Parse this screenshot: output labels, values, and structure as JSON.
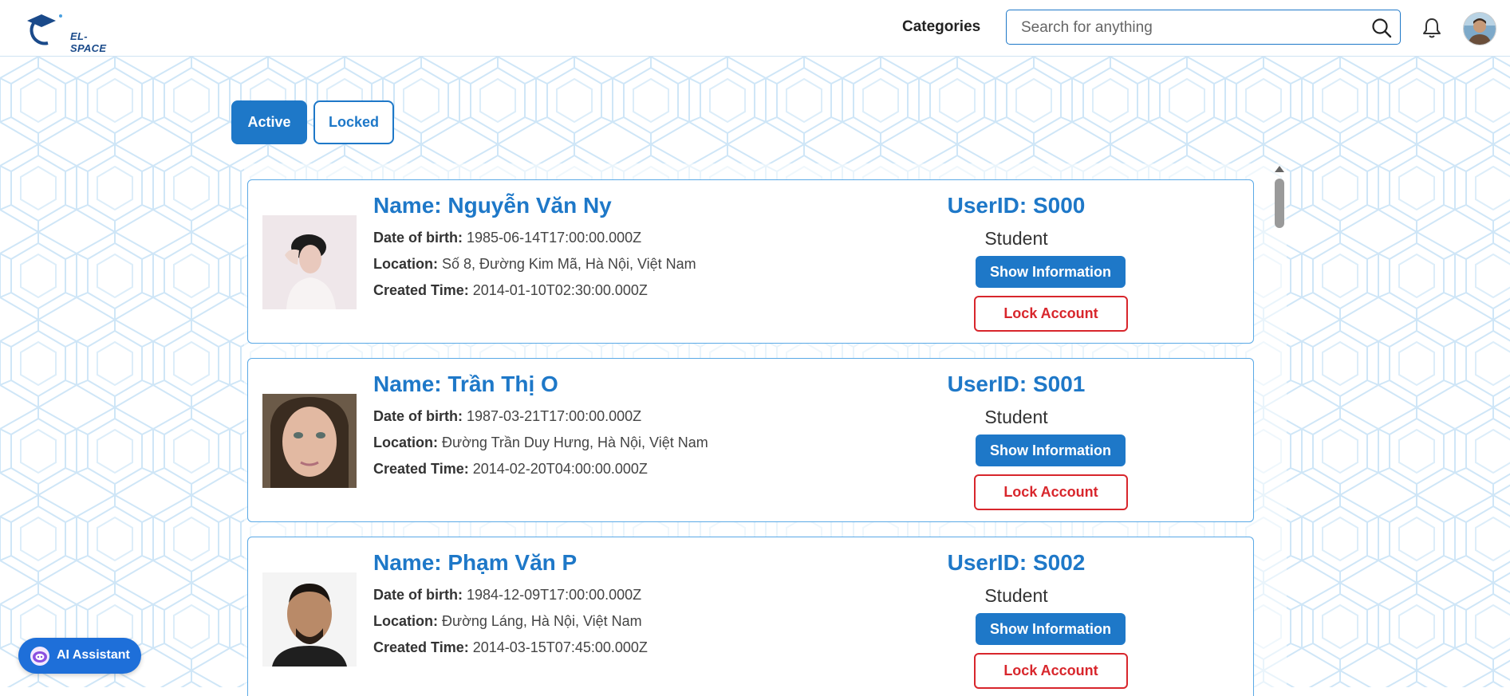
{
  "header": {
    "logo_text": "EL-SPACE",
    "categories_label": "Categories",
    "search_placeholder": "Search for anything"
  },
  "tabs": {
    "active_label": "Active",
    "locked_label": "Locked",
    "selected": "Active"
  },
  "labels": {
    "dob": "Date of birth:",
    "location": "Location:",
    "created": "Created Time:",
    "show_info": "Show Information",
    "lock": "Lock Account"
  },
  "users": [
    {
      "name": "Name: Nguyễn Văn Ny",
      "dob": "1985-06-14T17:00:00.000Z",
      "location": "Số 8, Đường Kim Mã, Hà Nội, Việt Nam",
      "created": "2014-01-10T02:30:00.000Z",
      "userid": "UserID: S000",
      "role": "Student"
    },
    {
      "name": "Name: Trần Thị O",
      "dob": "1987-03-21T17:00:00.000Z",
      "location": "Đường Trần Duy Hưng, Hà Nội, Việt Nam",
      "created": "2014-02-20T04:00:00.000Z",
      "userid": "UserID: S001",
      "role": "Student"
    },
    {
      "name": "Name: Phạm Văn P",
      "dob": "1984-12-09T17:00:00.000Z",
      "location": "Đường Láng, Hà Nội, Việt Nam",
      "created": "2014-03-15T07:45:00.000Z",
      "userid": "UserID: S002",
      "role": "Student"
    }
  ],
  "ai_assistant": {
    "label": "AI Assistant"
  },
  "colors": {
    "primary": "#1e78c8",
    "danger": "#d8262c",
    "pattern": "#cfe6f7"
  }
}
